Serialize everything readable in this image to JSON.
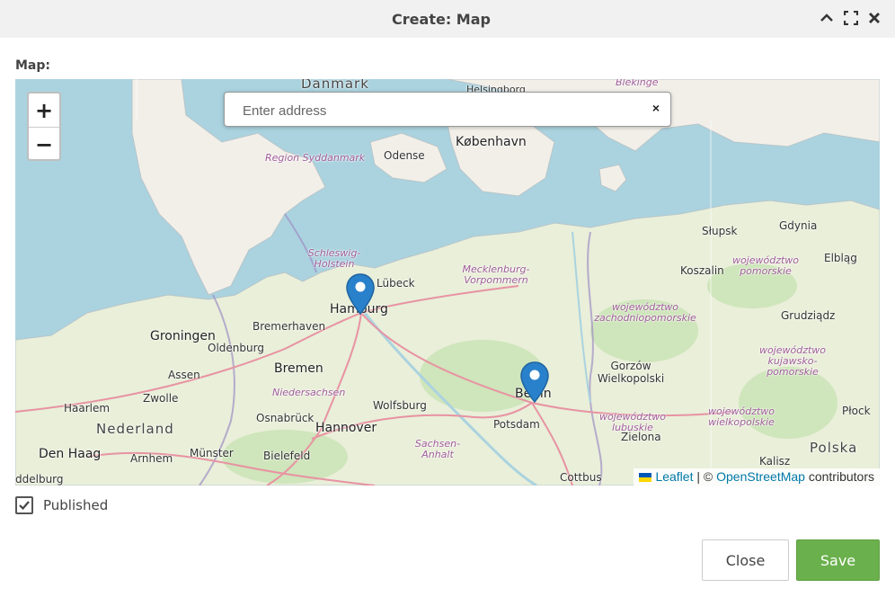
{
  "dialog": {
    "title": "Create: Map"
  },
  "field": {
    "label": "Map:"
  },
  "search": {
    "placeholder": "Enter address",
    "value": "",
    "clear_label": "×"
  },
  "zoom": {
    "in_label": "+",
    "out_label": "−"
  },
  "places": {
    "danmark": "Danmark",
    "helsingborg": "Helsingborg",
    "blekinge": "Blekinge",
    "kobenhavn": "København",
    "odense": "Odense",
    "syddanmark": "Region Syddanmark",
    "slupsk": "Słupsk",
    "gdynia": "Gdynia",
    "schleswig": "Schleswig-Holstein",
    "lubeck": "Lübeck",
    "mecklenburg": "Mecklenburg-Vorpommern",
    "koszalin": "Koszalin",
    "pomorskie": "województwo pomorskie",
    "elblag": "Elbląg",
    "hamburg": "Hamburg",
    "bremerhaven": "Bremerhaven",
    "zachodniopomorskie": "województwo zachodniopomorskie",
    "grudziadz": "Grudziądz",
    "groningen": "Groningen",
    "oldenburg": "Oldenburg",
    "bremen": "Bremen",
    "assen": "Assen",
    "kujawsko": "województwo kujawsko-pomorskie",
    "gorzow": "Gorzów Wielkopolski",
    "niedersachsen": "Niedersachsen",
    "zwolle": "Zwolle",
    "wolfsburg": "Wolfsburg",
    "berlin": "Berlin",
    "haarlem": "Haarlem",
    "nederland": "Nederland",
    "osnabruck": "Osnabrück",
    "hannover": "Hannover",
    "potsdam": "Potsdam",
    "lubuskie": "województwo lubuskie",
    "wielkopolskie": "województwo wielkopolskie",
    "plock": "Płock",
    "sachsen_anhalt": "Sachsen-Anhalt",
    "denhaag": "Den Haag",
    "arnhem": "Arnhem",
    "munster": "Münster",
    "bielefeld": "Bielefeld",
    "zielona": "Zielona",
    "kalisz": "Kalisz",
    "polska": "Polska",
    "cottbus": "Cottbus",
    "riddelburg": "ddelburg"
  },
  "attribution": {
    "leaflet": "Leaflet",
    "separator": " | © ",
    "osm": "OpenStreetMap",
    "contributors": " contributors"
  },
  "published": {
    "label": "Published",
    "checked": true
  },
  "buttons": {
    "close": "Close",
    "save": "Save"
  },
  "colors": {
    "save": "#6ab04c",
    "marker": "#2a81cb",
    "water": "#aad3df",
    "land": "#f2efe9",
    "link": "#0078a8"
  }
}
